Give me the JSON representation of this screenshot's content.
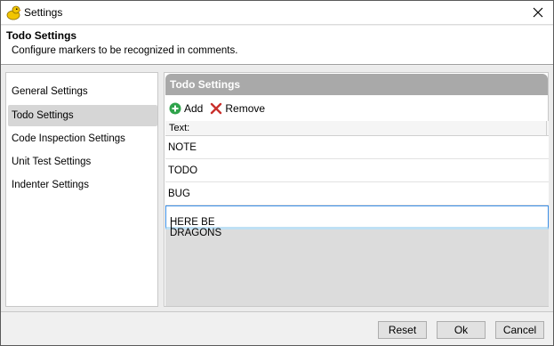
{
  "window": {
    "title": "Settings"
  },
  "header": {
    "title": "Todo Settings",
    "description": "Configure markers to be recognized in comments."
  },
  "nav": {
    "items": [
      {
        "label": "General Settings",
        "selected": false
      },
      {
        "label": "Todo Settings",
        "selected": true
      },
      {
        "label": "Code Inspection Settings",
        "selected": false
      },
      {
        "label": "Unit Test Settings",
        "selected": false
      },
      {
        "label": "Indenter Settings",
        "selected": false
      }
    ]
  },
  "content": {
    "title": "Todo Settings",
    "toolbar": {
      "add_label": "Add",
      "remove_label": "Remove"
    },
    "grid": {
      "column_header": "Text:",
      "rows": [
        "NOTE",
        "TODO",
        "BUG",
        "HERE BE DRAGONS"
      ],
      "editing_row_index": 3
    }
  },
  "footer": {
    "reset_label": "Reset",
    "ok_label": "Ok",
    "cancel_label": "Cancel"
  },
  "colors": {
    "add_icon": "#2fa34b",
    "remove_icon": "#c9302c",
    "content_header": "#a9a9a9",
    "edit_border": "#3a8ee6"
  }
}
